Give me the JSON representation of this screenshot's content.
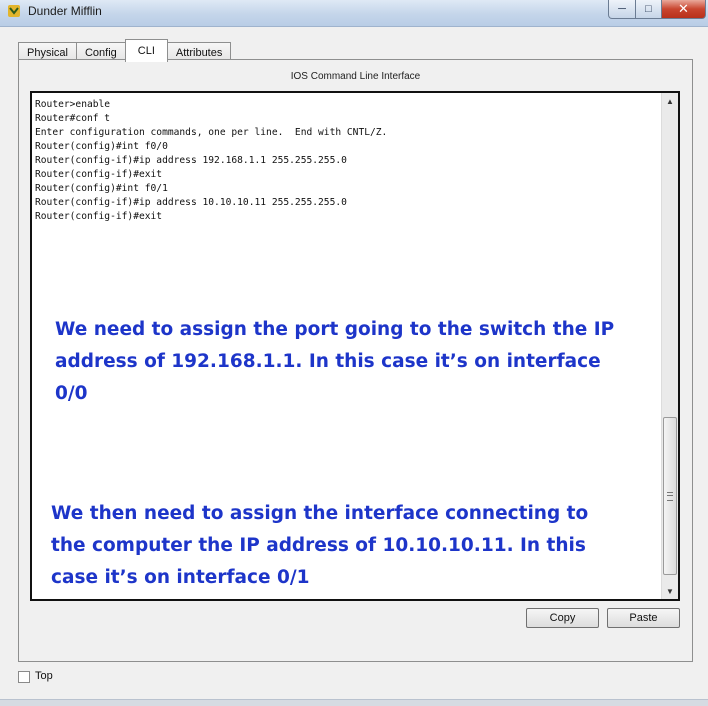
{
  "window": {
    "title": "Dunder Mifflin",
    "controls": {
      "minimize": "─",
      "maximize": "□",
      "close": "✕"
    }
  },
  "tabs": [
    {
      "label": "Physical"
    },
    {
      "label": "Config"
    },
    {
      "label": "CLI"
    },
    {
      "label": "Attributes"
    }
  ],
  "active_tab": "CLI",
  "panel": {
    "title": "IOS Command Line Interface"
  },
  "console": {
    "lines": [
      "Router>enable",
      "Router#conf t",
      "Enter configuration commands, one per line.  End with CNTL/Z.",
      "Router(config)#int f0/0",
      "Router(config-if)#ip address 192.168.1.1 255.255.255.0",
      "Router(config-if)#exit",
      "Router(config)#int f0/1",
      "Router(config-if)#ip address 10.10.10.11 255.255.255.0",
      "Router(config-if)#exit"
    ],
    "scroll_up_glyph": "▲",
    "scroll_down_glyph": "▼"
  },
  "annotations": [
    {
      "lines": [
        "We need to assign the port going to the switch the IP",
        "address of 192.168.1.1. In this case it’s on interface",
        "0/0"
      ],
      "color": "#1d35c9"
    },
    {
      "lines": [
        "We then need to assign the interface connecting to",
        "the computer the IP address of 10.10.10.11. In this",
        "case it’s on interface 0/1"
      ],
      "color": "#1d35c9"
    }
  ],
  "buttons": {
    "copy": "Copy",
    "paste": "Paste"
  },
  "top_checkbox": {
    "label": "Top",
    "checked": false
  }
}
